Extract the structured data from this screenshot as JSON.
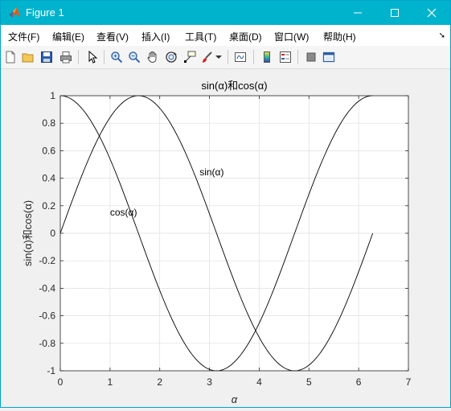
{
  "window": {
    "title": "Figure 1",
    "titlebar_color": "#00b3cc"
  },
  "menu": [
    {
      "label": "文件(F)"
    },
    {
      "label": "编辑(E)"
    },
    {
      "label": "查看(V)"
    },
    {
      "label": "插入(I)"
    },
    {
      "label": "工具(T)"
    },
    {
      "label": "桌面(D)"
    },
    {
      "label": "窗口(W)"
    },
    {
      "label": "帮助(H)"
    }
  ],
  "toolbar": {
    "icons": [
      "new-figure-icon",
      "open-file-icon",
      "save-icon",
      "print-icon",
      "edit-plot-pointer-icon",
      "zoom-in-icon",
      "zoom-out-icon",
      "pan-hand-icon",
      "rotate-3d-icon",
      "data-cursor-icon",
      "brush-icon",
      "link-plot-icon",
      "colorbar-icon",
      "legend-icon",
      "hide-plot-tools-icon",
      "show-plot-tools-icon"
    ]
  },
  "chart_data": {
    "type": "line",
    "title": "sin(α)和cos(α)",
    "xlabel": "α",
    "ylabel": "sin(α)和cos(α)",
    "xlim": [
      0,
      7
    ],
    "ylim": [
      -1,
      1
    ],
    "xticks": [
      "0",
      "1",
      "2",
      "3",
      "4",
      "5",
      "6",
      "7"
    ],
    "yticks": [
      "-1",
      "-0.8",
      "-0.6",
      "-0.4",
      "-0.2",
      "0",
      "0.2",
      "0.4",
      "0.6",
      "0.8",
      "1"
    ],
    "grid": true,
    "line_color": "#000000",
    "series": [
      {
        "label": "sin(α)",
        "function": "sin",
        "x_range": [
          0,
          6.2832
        ],
        "annotation_at": [
          2.8,
          0.42
        ]
      },
      {
        "label": "cos(α)",
        "function": "cos",
        "x_range": [
          0,
          6.2832
        ],
        "annotation_at": [
          1.0,
          0.13
        ]
      }
    ]
  }
}
